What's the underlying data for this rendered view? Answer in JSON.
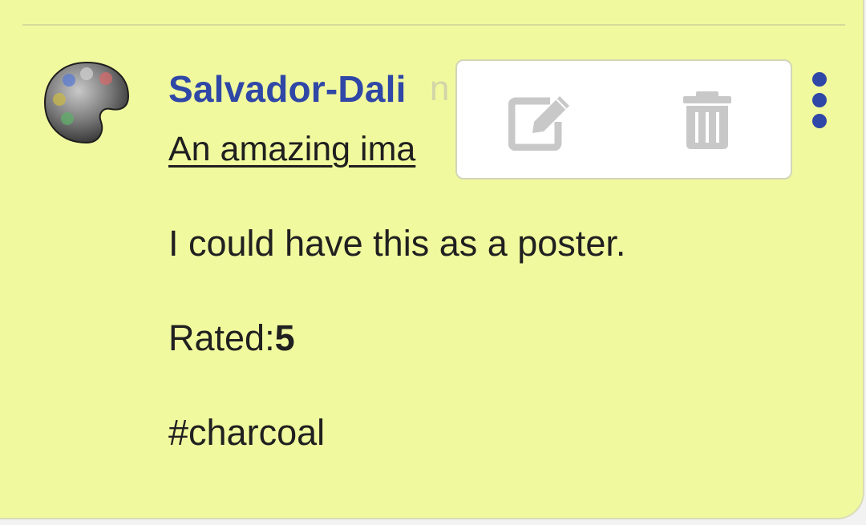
{
  "post": {
    "author": "Salvador-Dali",
    "timestamp_partial": "n",
    "title": "An amazing ima",
    "comment": "I could have this as a poster.",
    "rating_label": "Rated:",
    "rating_value": "5",
    "tag": "#charcoal"
  },
  "popup_menu": {
    "actions": [
      {
        "icon": "edit-icon"
      },
      {
        "icon": "trash-icon"
      }
    ]
  },
  "icons": {
    "avatar": "palette-icon",
    "more": "more-vertical-icon"
  },
  "colors": {
    "card_background": "#f1f99e",
    "author_color": "#2f47a6",
    "icon_gray": "#c8c8c8",
    "text_color": "#202020"
  }
}
